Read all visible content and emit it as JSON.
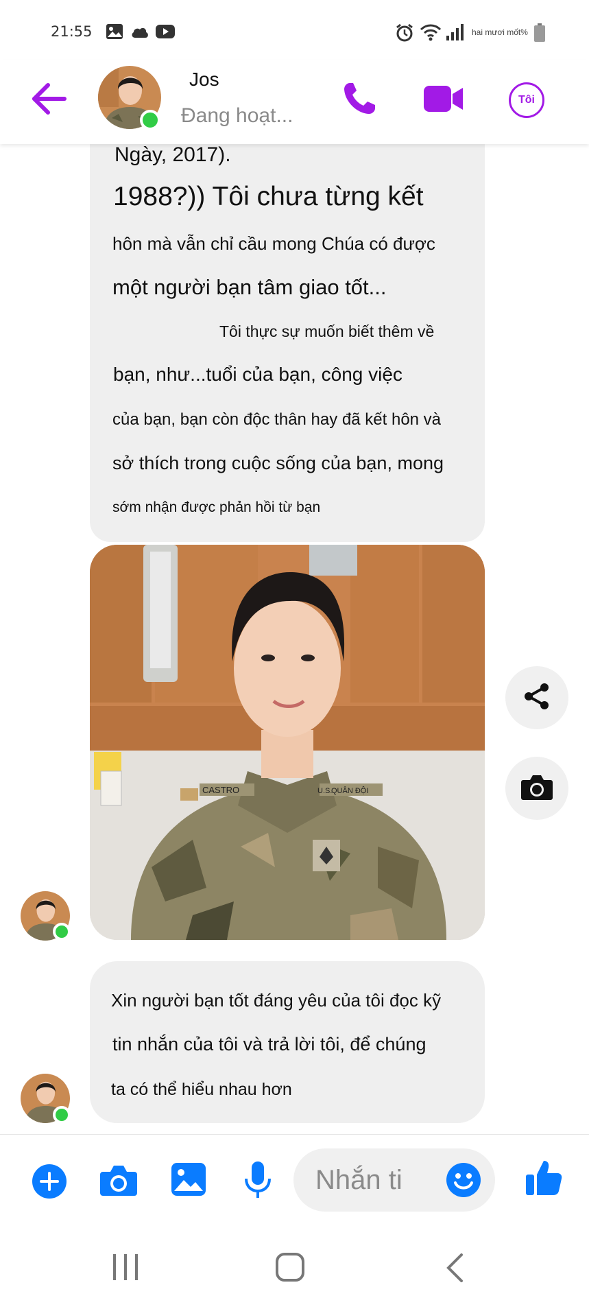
{
  "status_bar": {
    "time": "21:55",
    "battery_text": "hai mươi mốt%"
  },
  "header": {
    "contact_name": "Jos",
    "contact_status": "Đang hoạt...",
    "profile_badge": "Tôi"
  },
  "messages": {
    "block1": {
      "lines": [
        "Ngày, 2017).",
        "1988?)) Tôi chưa từng kết",
        "hôn mà vẫn chỉ cầu mong Chúa có được",
        "một người bạn tâm giao tốt...",
        "Tôi thực sự muốn biết thêm về",
        "bạn, như...tuổi của bạn, công việc",
        "của bạn, bạn còn độc thân hay đã kết hôn và",
        "sở thích trong cuộc sống của bạn, mong",
        "sớm nhận được phản hồi từ bạn"
      ]
    },
    "photo": {
      "name_tape": "CASTRO",
      "branch_tape": "QUÂN ĐỘI",
      "us_tape": "U.S."
    },
    "block2": {
      "lines": [
        "Xin người bạn tốt đáng yêu của tôi đọc kỹ",
        "tin nhắn của tôi và trả lời tôi, để chúng",
        "ta có thể hiểu nhau hơn"
      ]
    }
  },
  "composer": {
    "placeholder": "Nhắn ti"
  },
  "colors": {
    "messenger_purple": "#a21ae6",
    "messenger_blue": "#0a7cff",
    "online_green": "#31cc46",
    "bubble_gray": "#efefef"
  },
  "icons": [
    "back-arrow-icon",
    "phone-icon",
    "video-camera-icon",
    "share-icon",
    "camera-icon",
    "plus-icon",
    "camera-icon",
    "gallery-icon",
    "microphone-icon",
    "emoji-icon",
    "thumbs-up-icon",
    "recent-apps-icon",
    "home-icon",
    "nav-back-icon"
  ]
}
